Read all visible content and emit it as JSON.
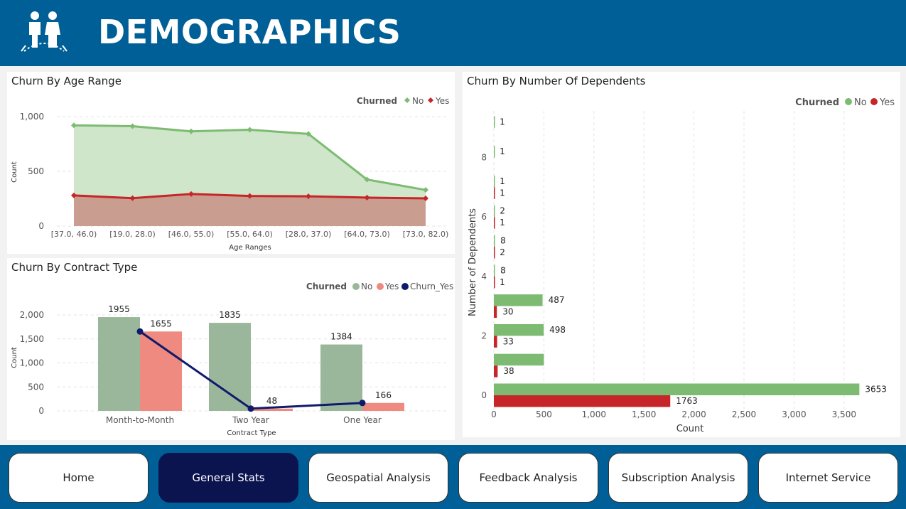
{
  "header": {
    "title": "DEMOGRAPHICS",
    "logo_icon": "people-group-icon"
  },
  "age_panel": {
    "title": "Churn By Age Range",
    "legend_title": "Churned",
    "legend_no": "No",
    "legend_yes": "Yes",
    "y_axis_label": "Count",
    "x_axis_label": "Age Ranges",
    "y_ticks": [
      "0",
      "500",
      "1,000"
    ]
  },
  "contract_panel": {
    "title": "Churn By Contract Type",
    "legend_title": "Churned",
    "legend_no": "No",
    "legend_yes": "Yes",
    "legend_line": "Churn_Yes",
    "y_axis_label": "Count",
    "x_axis_label": "Contract Type",
    "y_ticks": [
      "0",
      "500",
      "1,000",
      "1,500",
      "2,000"
    ]
  },
  "dependents_panel": {
    "title": "Churn By Number Of Dependents",
    "legend_title": "Churned",
    "legend_no": "No",
    "legend_yes": "Yes",
    "y_axis_label": "Number of Dependents",
    "x_axis_label": "Count",
    "x_ticks": [
      "0",
      "500",
      "1,000",
      "1,500",
      "2,000",
      "2,500",
      "3,000",
      "3,500"
    ],
    "y_ticks": [
      "0",
      "2",
      "4",
      "6",
      "8"
    ]
  },
  "colors": {
    "header_blue": "#005f96",
    "nav_active": "#0c144f",
    "no_green": "#7dbb73",
    "yes_red": "#c62627",
    "contract_no": "#9bb79b",
    "contract_yes": "#ee8a7f",
    "churn_line": "#101a6b"
  },
  "chart_data": [
    {
      "type": "area",
      "title": "Churn By Age Range",
      "xlabel": "Age Ranges",
      "ylabel": "Count",
      "ylim": [
        0,
        1000
      ],
      "categories": [
        "[37.0, 46.0)",
        "[19.0, 28.0)",
        "[46.0, 55.0)",
        "[55.0, 64.0)",
        "[28.0, 37.0)",
        "[64.0, 73.0)",
        "[73.0, 82.0)"
      ],
      "series": [
        {
          "name": "No",
          "values": [
            920,
            912,
            865,
            880,
            842,
            425,
            330
          ]
        },
        {
          "name": "Yes",
          "values": [
            280,
            255,
            293,
            275,
            272,
            260,
            253
          ]
        }
      ],
      "legend": "top-right",
      "grid": true
    },
    {
      "type": "bar",
      "title": "Churn By Contract Type",
      "xlabel": "Contract Type",
      "ylabel": "Count",
      "ylim": [
        0,
        2000
      ],
      "categories": [
        "Month-to-Month",
        "Two Year",
        "One Year"
      ],
      "series": [
        {
          "name": "No",
          "values": [
            1955,
            1835,
            1384
          ]
        },
        {
          "name": "Yes",
          "values": [
            1655,
            48,
            166
          ]
        },
        {
          "name": "Churn_Yes",
          "values": [
            1655,
            48,
            166
          ]
        }
      ],
      "legend": "top-right",
      "grid": true
    },
    {
      "type": "bar",
      "orientation": "horizontal",
      "title": "Churn By Number Of Dependents",
      "xlabel": "Count",
      "ylabel": "Number of Dependents",
      "xlim": [
        0,
        3700
      ],
      "categories": [
        "0",
        "1",
        "2",
        "3",
        "4",
        "5",
        "6",
        "7",
        "8",
        "9"
      ],
      "series": [
        {
          "name": "No",
          "values": [
            3653,
            500,
            498,
            487,
            8,
            8,
            2,
            1,
            1,
            1
          ]
        },
        {
          "name": "Yes",
          "values": [
            1763,
            38,
            33,
            30,
            1,
            2,
            1,
            1,
            null,
            null
          ]
        }
      ],
      "labels_no": [
        "3653",
        "",
        "498",
        "487",
        "8",
        "8",
        "2",
        "1",
        "1",
        "1"
      ],
      "labels_yes": [
        "1763",
        "38",
        "33",
        "30",
        "1",
        "2",
        "1",
        "1",
        "",
        ""
      ],
      "legend": "top-right",
      "grid": true
    }
  ],
  "nav": {
    "items": [
      {
        "label": "Home",
        "active": false
      },
      {
        "label": "General Stats",
        "active": true
      },
      {
        "label": "Geospatial Analysis",
        "active": false
      },
      {
        "label": "Feedback Analysis",
        "active": false
      },
      {
        "label": "Subscription Analysis",
        "active": false
      },
      {
        "label": "Internet Service",
        "active": false
      }
    ]
  }
}
